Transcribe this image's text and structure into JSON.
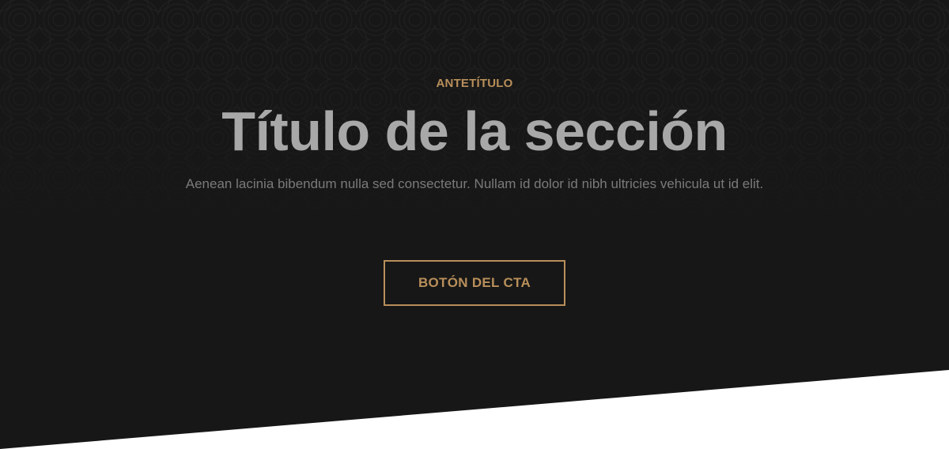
{
  "colors": {
    "background": "#171717",
    "accent": "#b88f5a",
    "title": "#a8a8a8",
    "description": "#7a7a7a",
    "below_section": "#ffffff"
  },
  "hero": {
    "eyebrow": "ANTETÍTULO",
    "title": "Título de la sección",
    "description": "Aenean lacinia bibendum nulla sed consectetur. Nullam id dolor id nibh ultricies vehicula ut id elit.",
    "cta_label": "BOTÓN DEL CTA"
  }
}
